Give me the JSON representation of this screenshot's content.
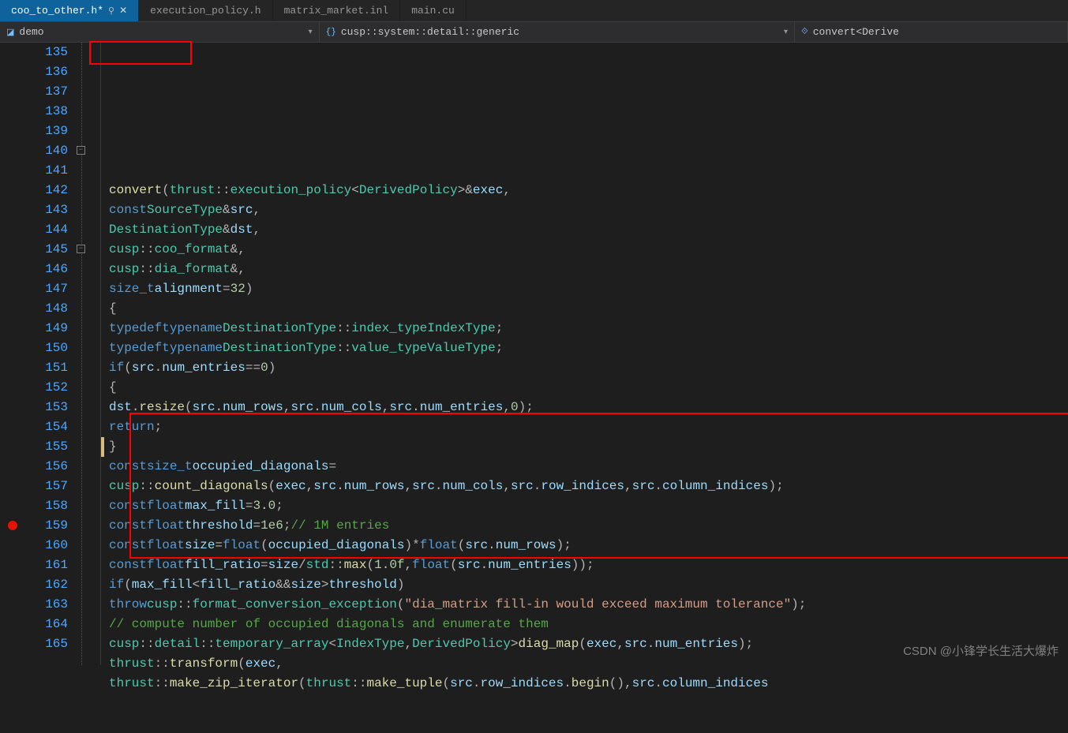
{
  "tabs": [
    {
      "label": "coo_to_other.h*",
      "active": true,
      "pinned": true,
      "closable": true
    },
    {
      "label": "execution_policy.h",
      "active": false
    },
    {
      "label": "matrix_market.inl",
      "active": false
    },
    {
      "label": "main.cu",
      "active": false
    }
  ],
  "nav": {
    "scope1": "demo",
    "scope2": "cusp::system::detail::generic",
    "scope3": "convert<Derive"
  },
  "line_start": 135,
  "line_end": 165,
  "breakpoint_line": 159,
  "change_marker_lines": [
    155
  ],
  "fold_markers": [
    {
      "line": 140,
      "glyph": "−"
    },
    {
      "line": 145,
      "glyph": "−"
    }
  ],
  "highlight_boxes": {
    "box1_desc": "around convert(th on line 135",
    "box2_desc": "around lines 154-160 block"
  },
  "code_lines": {
    "l135": "convert(thrust::execution_policy<DerivedPolicy>& exec,",
    "l136": "        const SourceType& src,",
    "l137": "        DestinationType& dst,",
    "l138": "        cusp::coo_format&,",
    "l139": "        cusp::dia_format&,",
    "l140": "        size_t alignment = 32)",
    "l141": "{",
    "l142": "    typedef typename DestinationType::index_type   IndexType;",
    "l143": "    typedef typename DestinationType::value_type   ValueType;",
    "l144": "",
    "l145": "    if(src.num_entries == 0)",
    "l146": "    {",
    "l147": "        dst.resize(src.num_rows, src.num_cols, src.num_entries, 0);",
    "l148": "        return;",
    "l149": "    }",
    "l150": "",
    "l151": "    const size_t occupied_diagonals =",
    "l152": "        cusp::count_diagonals(exec, src.num_rows, src.num_cols, src.row_indices, src.column_indices);",
    "l153": "",
    "l154": "    const float max_fill   = 3.0;",
    "l155": "    const float threshold  = 1e6; // 1M entries",
    "l156": "    const float size       = float(occupied_diagonals) * float(src.num_rows);",
    "l157": "    const float fill_ratio = size / std::max(1.0f, float(src.num_entries));",
    "l158": "",
    "l159": "    if (max_fill < fill_ratio && size > threshold)",
    "l160": "        throw cusp::format_conversion_exception(\"dia_matrix fill-in would exceed maximum tolerance\");",
    "l161": "",
    "l162": "    // compute number of occupied diagonals and enumerate them",
    "l163": "    cusp::detail::temporary_array<IndexType, DerivedPolicy> diag_map(exec, src.num_entries);",
    "l164": "    thrust::transform(exec,",
    "l165": "                      thrust::make_zip_iterator( thrust::make_tuple( src.row_indices.begin(), src.column_indices"
  },
  "watermark": "CSDN @小锋学长生活大爆炸"
}
